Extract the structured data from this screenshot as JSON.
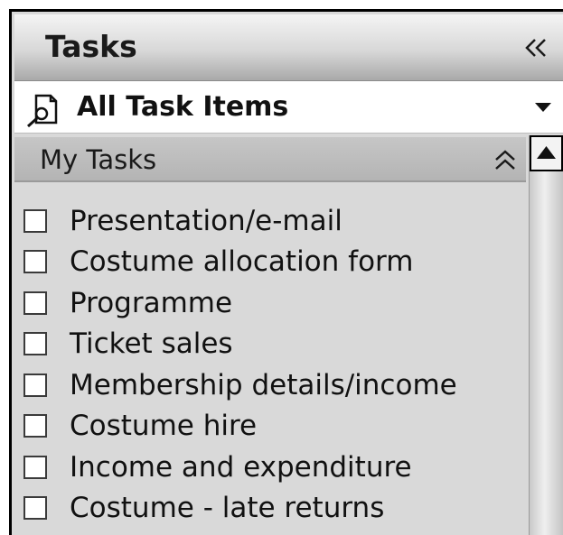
{
  "header": {
    "title": "Tasks",
    "collapse_icon": "double-chevron-left-icon"
  },
  "selector": {
    "icon": "search-document-icon",
    "label": "All Task Items",
    "dropdown_icon": "caret-down-icon"
  },
  "section": {
    "title": "My Tasks",
    "toggle_icon": "double-chevron-up-icon"
  },
  "tasks": [
    {
      "label": "Presentation/e-mail",
      "checked": false
    },
    {
      "label": "Costume allocation form",
      "checked": false
    },
    {
      "label": "Programme",
      "checked": false
    },
    {
      "label": "Ticket sales",
      "checked": false
    },
    {
      "label": "Membership details/income",
      "checked": false
    },
    {
      "label": "Costume hire",
      "checked": false
    },
    {
      "label": "Income and expenditure",
      "checked": false
    },
    {
      "label": "Costume - late returns",
      "checked": false
    }
  ]
}
